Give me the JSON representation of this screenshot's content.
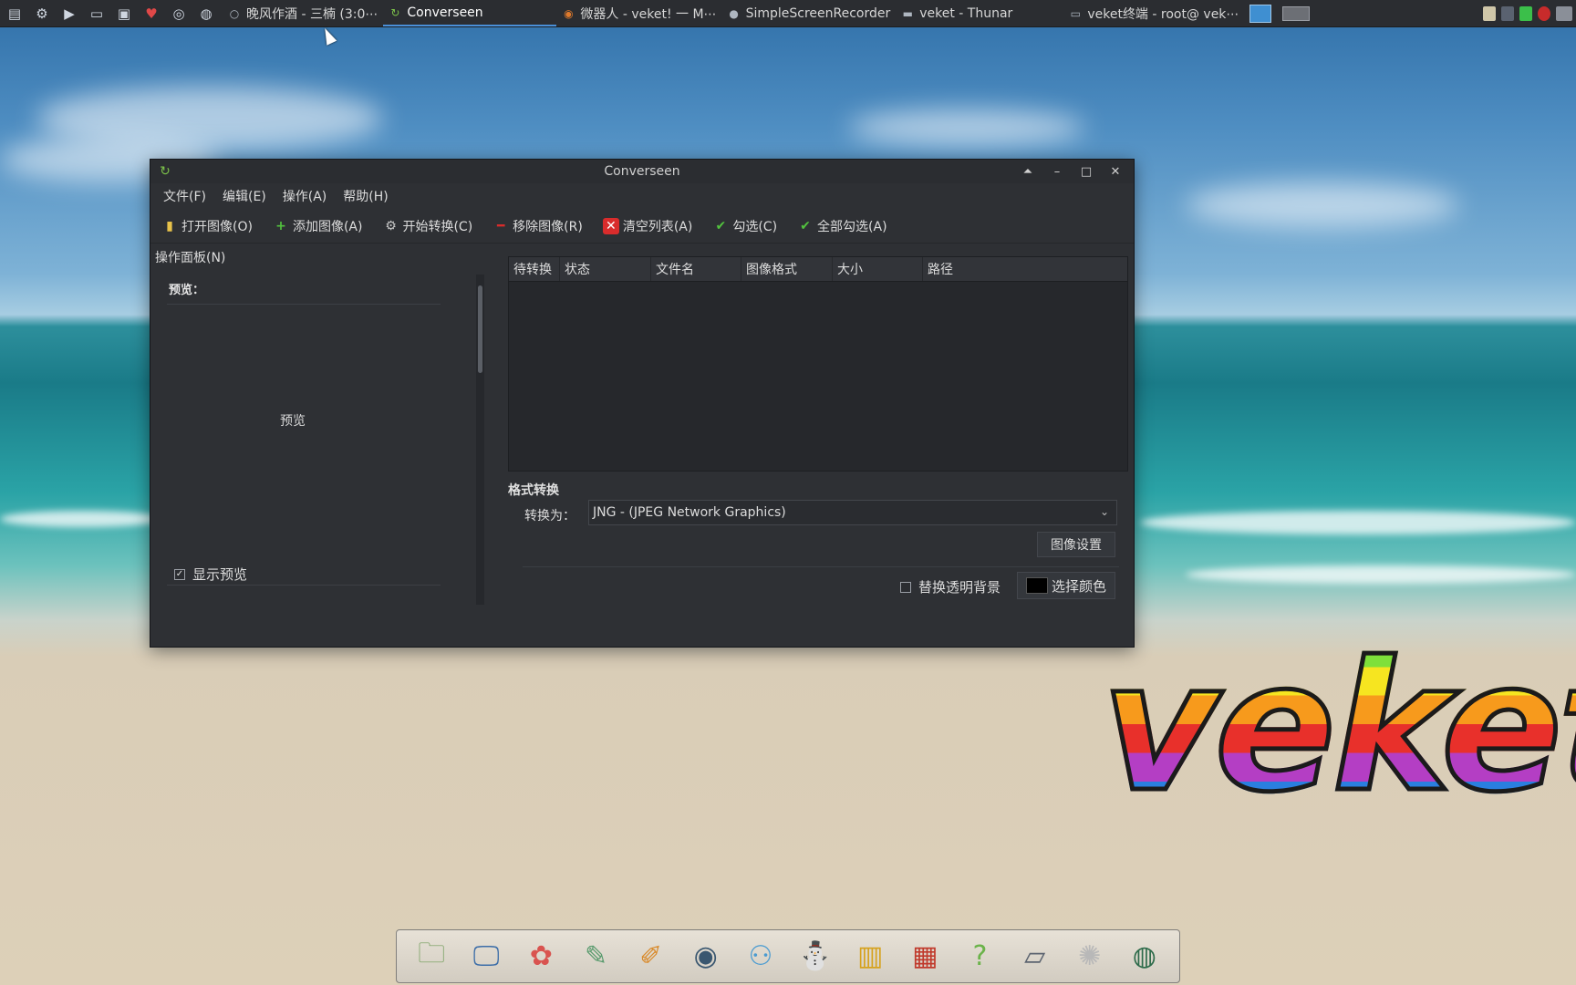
{
  "taskbar": {
    "tasks": [
      {
        "label": "晚风作酒 - 三楠 (3:0⋯",
        "icon": "music-icon"
      },
      {
        "label": "Converseen",
        "icon": "converseen-icon",
        "active": true
      },
      {
        "label": "微器人 - veket! 一 M⋯",
        "icon": "firefox-icon"
      },
      {
        "label": "SimpleScreenRecorder",
        "icon": "recorder-icon"
      },
      {
        "label": "veket - Thunar",
        "icon": "folder-icon"
      },
      {
        "label": "veket终端 - root@ vek⋯",
        "icon": "terminal-icon"
      }
    ]
  },
  "window": {
    "title": "Converseen",
    "menu": {
      "file": "文件(F)",
      "edit": "编辑(E)",
      "action": "操作(A)",
      "help": "帮助(H)"
    },
    "toolbar": {
      "open": "打开图像(O)",
      "add": "添加图像(A)",
      "convert": "开始转换(C)",
      "remove": "移除图像(R)",
      "clear": "清空列表(A)",
      "check": "勾选(C)",
      "check_all": "全部勾选(A)"
    },
    "left_panel": {
      "title": "操作面板(N)",
      "preview_label": "预览：",
      "preview_placeholder": "预览",
      "show_preview": "显示预览"
    },
    "table": {
      "columns": [
        "待转换",
        "状态",
        "文件名",
        "图像格式",
        "大小",
        "路径"
      ],
      "rows": []
    },
    "format": {
      "section_title": "格式转换",
      "convert_to_label": "转换为：",
      "selected_format": "JNG - (JPEG Network Graphics)",
      "image_settings": "图像设置",
      "replace_transparent": "替换透明背景",
      "pick_color": "选择颜色",
      "swatch_color": "#000000"
    }
  },
  "desktop": {
    "logo_text": "veket"
  },
  "dock": {
    "items": [
      "folder-icon",
      "monitor-icon",
      "mascot-icon",
      "editor-icon",
      "paint-icon",
      "disc-icon",
      "network-icon",
      "penguin-icon",
      "notebook-icon",
      "chart-icon",
      "help-icon",
      "scanner-icon",
      "settings-icon",
      "globe-icon"
    ]
  }
}
